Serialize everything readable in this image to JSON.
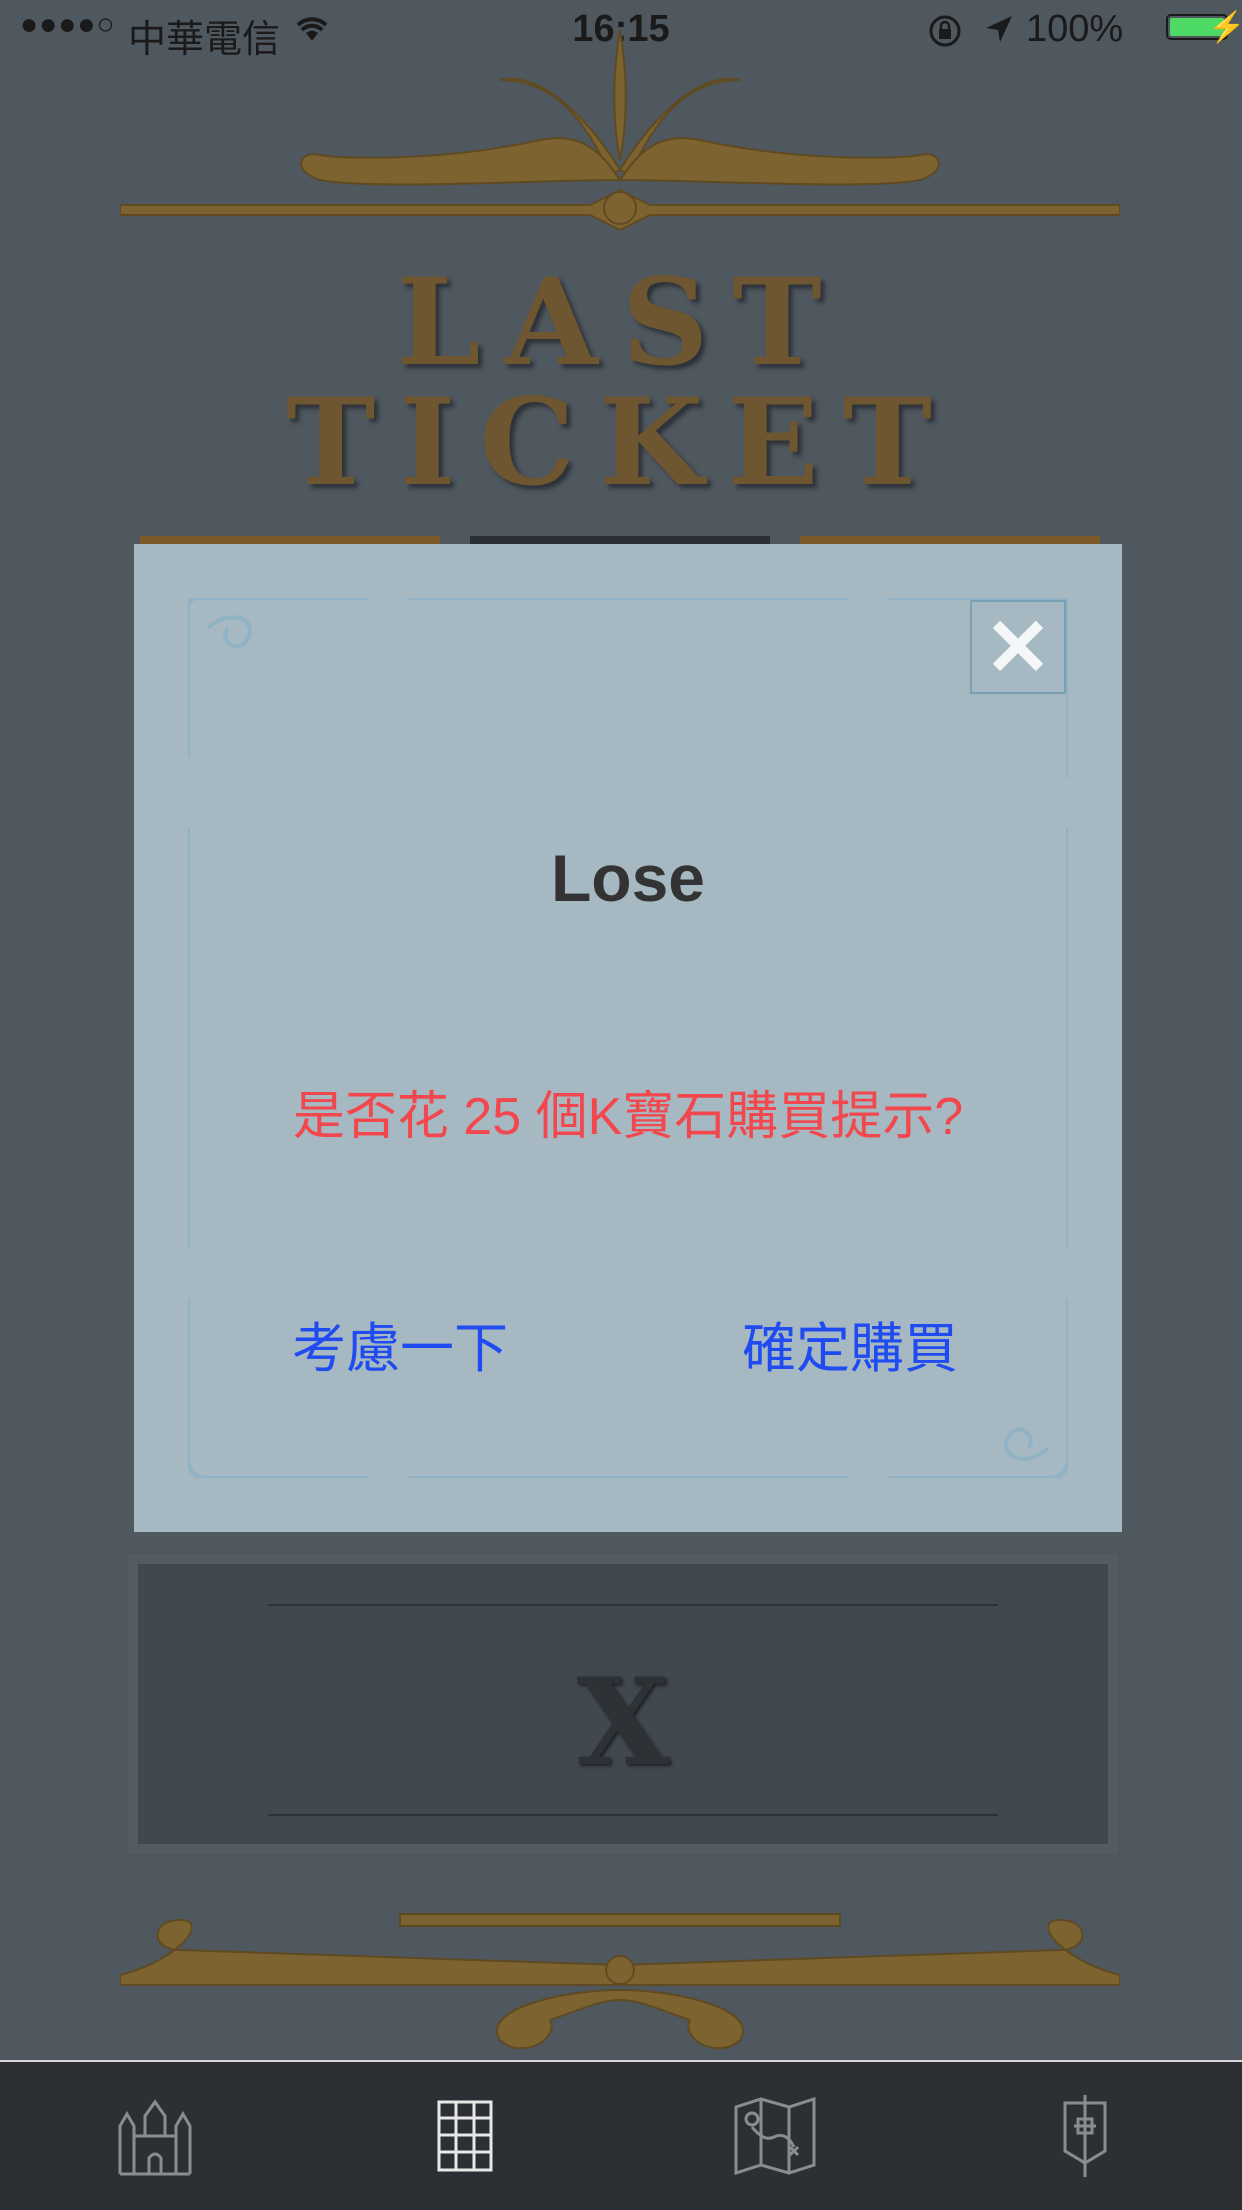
{
  "status_bar": {
    "signal": "●●●●○",
    "carrier": "中華電信",
    "time": "16:15",
    "battery_pct": "100%",
    "battery_level": 1.0,
    "wifi_icon": "wifi-icon",
    "lock_icon": "orientation-lock-icon",
    "location_icon": "location-arrow-icon",
    "charging_icon": "bolt-icon"
  },
  "game": {
    "title_line1": "LAST",
    "title_line2": "TICKET",
    "answer_letter": "X"
  },
  "dialog": {
    "title": "Lose",
    "message": "是否花 25 個K寶石購買提示?",
    "cancel_label": "考慮一下",
    "confirm_label": "確定購買",
    "close_label": "✕"
  },
  "tab_bar": {
    "items": [
      {
        "icon": "castle-icon"
      },
      {
        "icon": "grid-icon",
        "selected": true
      },
      {
        "icon": "map-icon"
      },
      {
        "icon": "banner-icon"
      }
    ]
  },
  "colors": {
    "background": "#4f575f",
    "dialog_bg": "#a6b9c3",
    "accent_gold": "#7c6330",
    "message_red": "#f2474d",
    "button_blue": "#1f4bf0",
    "tabbar_bg": "#2c3035"
  }
}
